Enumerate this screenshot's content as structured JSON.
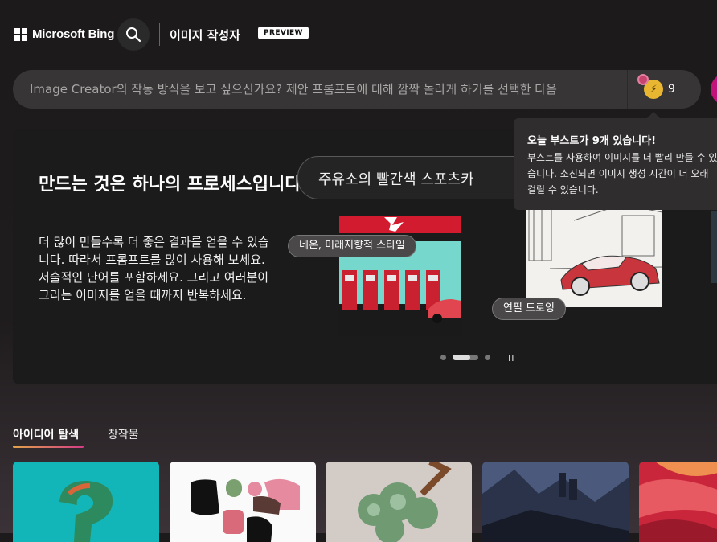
{
  "header": {
    "brand": "Microsoft Bing",
    "app_title": "이미지 작성자",
    "preview_badge": "PREVIEW"
  },
  "prompt": {
    "placeholder": "Image Creator의 작동 방식을 보고 싶으신가요? 제안 프롬프트에 대해 깜짝 놀라게 하기를 선택한 다음"
  },
  "boost": {
    "count": "9"
  },
  "tooltip": {
    "title": "오늘 부스트가 9개 있습니다!",
    "body": "부스트를 사용하여 이미지를 더 빨리 만들 수 있습니다. 소진되면 이미지 생성 시간이 더 오래 걸릴 수 있습니다."
  },
  "hero": {
    "title": "만드는 것은 하나의 프로세스입니다.",
    "description": "더 많이 만들수록 더 좋은 결과를 얻을 수 있습니다. 따라서 프롬프트를 많이 사용해 보세요. 서술적인 단어를 포함하세요. 그리고 여러분이 그리는 이미지를 얻을 때까지 반복하세요.",
    "example_prompt": "주유소의 빨간색 스포츠카",
    "tag_neon": "네온, 미래지향적 스타일",
    "tag_sketch": "연필 드로잉",
    "pause_label": "II"
  },
  "tabs": {
    "explore": "아이디어 탐색",
    "creations": "창작물"
  },
  "colors": {
    "accent_gradient_start": "#e0a34a",
    "accent_gradient_end": "#d43d86",
    "avatar": "#c3127a",
    "boost": "#e9b631"
  }
}
